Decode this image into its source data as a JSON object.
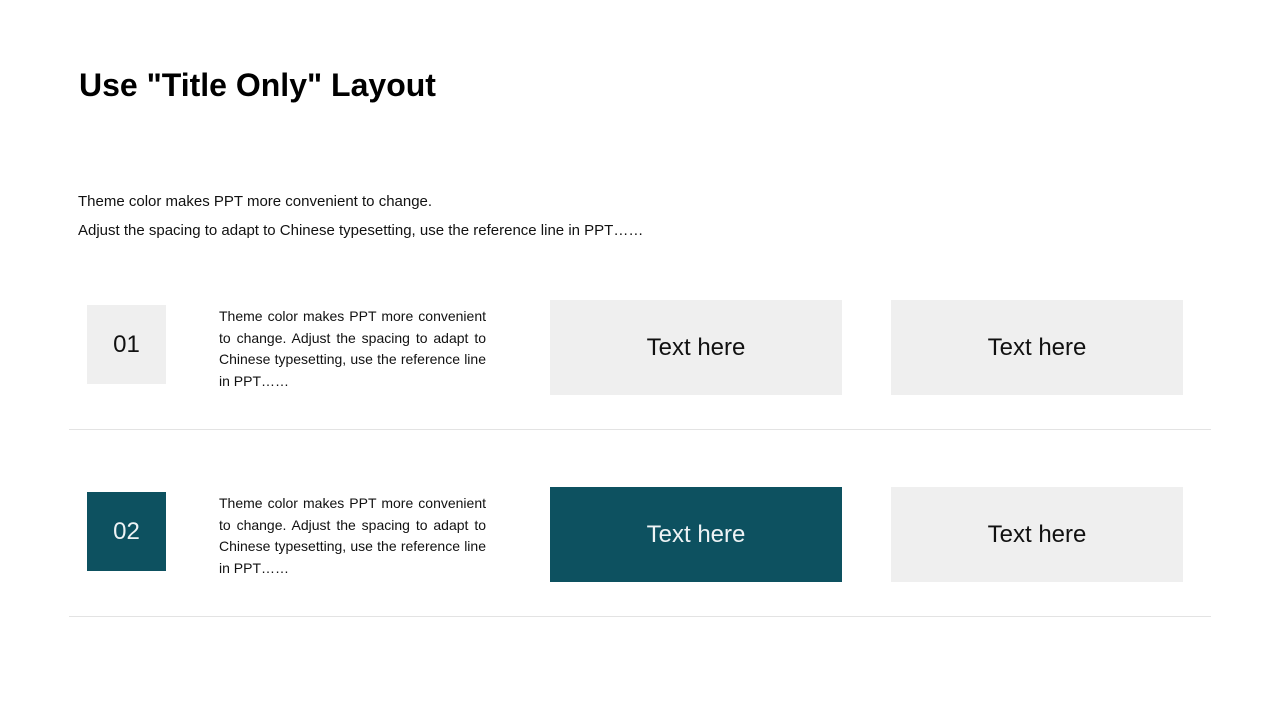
{
  "slide": {
    "title": "Use \"Title Only\" Layout",
    "intro_lines": [
      "Theme color makes PPT more convenient to change.",
      "Adjust the spacing to adapt to Chinese typesetting, use the reference line in PPT……"
    ]
  },
  "rows": [
    {
      "number": "01",
      "description": "Theme color makes PPT more convenient to change. Adjust the spacing to adapt to Chinese typesetting, use the reference line in PPT……",
      "cards": [
        "Text here",
        "Text here"
      ],
      "highlighted": false
    },
    {
      "number": "02",
      "description": "Theme color makes PPT more convenient to change. Adjust the spacing to adapt to Chinese typesetting, use the reference line in PPT……",
      "cards": [
        "Text here",
        "Text here"
      ],
      "highlighted": true
    }
  ],
  "colors": {
    "accent": "#0d5160",
    "light_box": "#efefef",
    "divider": "#e3e3e3"
  }
}
